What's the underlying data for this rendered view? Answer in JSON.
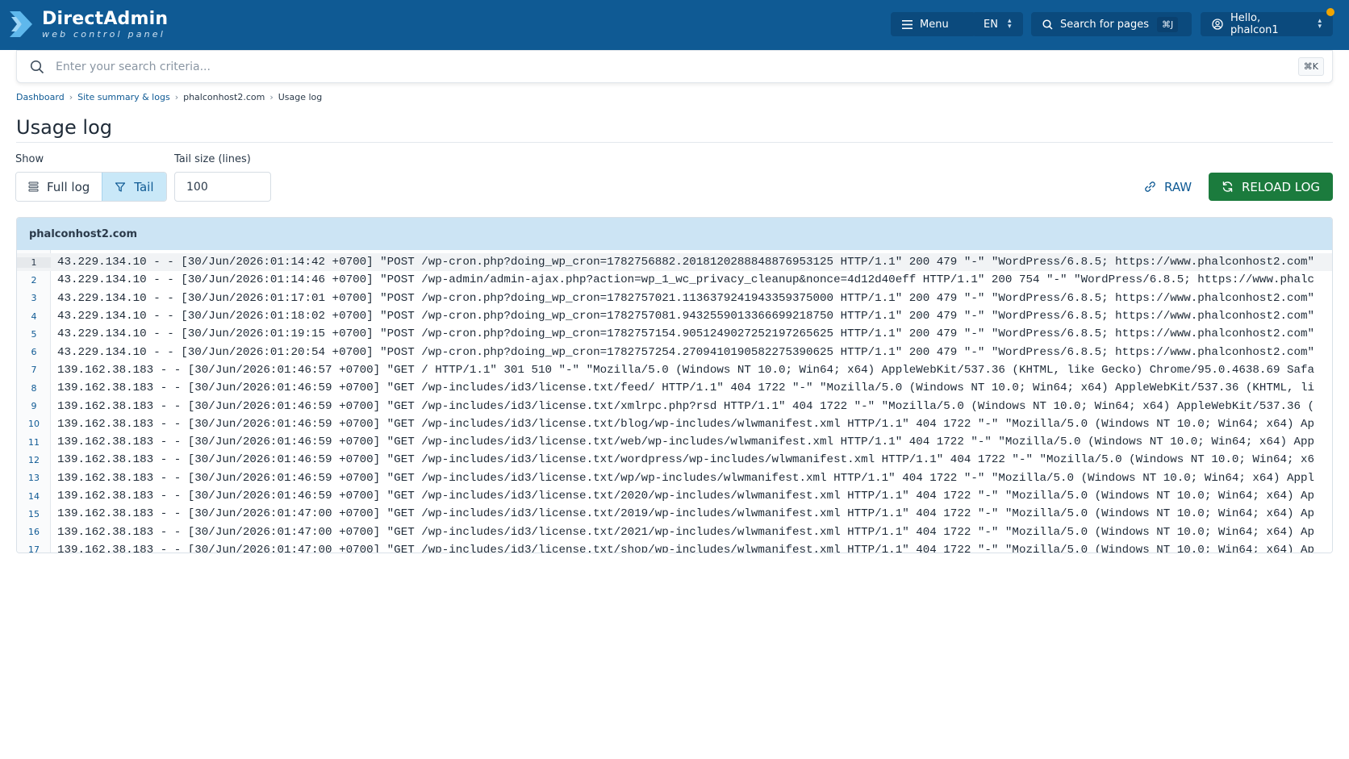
{
  "brand": {
    "title": "DirectAdmin",
    "subtitle": "web control panel"
  },
  "header": {
    "menu_label": "Menu",
    "language": "EN",
    "search_pages_label": "Search for pages",
    "search_pages_shortcut": "⌘J",
    "user_label": "Hello, phalcon1"
  },
  "search": {
    "placeholder": "Enter your search criteria...",
    "shortcut": "⌘K"
  },
  "breadcrumb": [
    "Dashboard",
    "Site summary & logs",
    "phalconhost2.com",
    "Usage log"
  ],
  "page": {
    "title": "Usage log"
  },
  "controls": {
    "show_label": "Show",
    "full_log_label": "Full log",
    "tail_label": "Tail",
    "tail_size_label": "Tail size (lines)",
    "tail_size_value": "100",
    "raw_label": "RAW",
    "reload_label": "RELOAD LOG"
  },
  "log": {
    "domain": "phalconhost2.com",
    "active_line": 1,
    "lines": [
      {
        "n": "1",
        "text": "43.229.134.10 - - [30/Jun/2026:01:14:42 +0700] \"POST /wp-cron.php?doing_wp_cron=1782756882.2018120288848876953125 HTTP/1.1\" 200 479 \"-\" \"WordPress/6.8.5; https://www.phalconhost2.com\""
      },
      {
        "n": "2",
        "text": "43.229.134.10 - - [30/Jun/2026:01:14:46 +0700] \"POST /wp-admin/admin-ajax.php?action=wp_1_wc_privacy_cleanup&nonce=4d12d40eff HTTP/1.1\" 200 754 \"-\" \"WordPress/6.8.5; https://www.phalc"
      },
      {
        "n": "3",
        "text": "43.229.134.10 - - [30/Jun/2026:01:17:01 +0700] \"POST /wp-cron.php?doing_wp_cron=1782757021.1136379241943359375000 HTTP/1.1\" 200 479 \"-\" \"WordPress/6.8.5; https://www.phalconhost2.com\""
      },
      {
        "n": "4",
        "text": "43.229.134.10 - - [30/Jun/2026:01:18:02 +0700] \"POST /wp-cron.php?doing_wp_cron=1782757081.9432559013366699218750 HTTP/1.1\" 200 479 \"-\" \"WordPress/6.8.5; https://www.phalconhost2.com\""
      },
      {
        "n": "5",
        "text": "43.229.134.10 - - [30/Jun/2026:01:19:15 +0700] \"POST /wp-cron.php?doing_wp_cron=1782757154.9051249027252197265625 HTTP/1.1\" 200 479 \"-\" \"WordPress/6.8.5; https://www.phalconhost2.com\""
      },
      {
        "n": "6",
        "text": "43.229.134.10 - - [30/Jun/2026:01:20:54 +0700] \"POST /wp-cron.php?doing_wp_cron=1782757254.2709410190582275390625 HTTP/1.1\" 200 479 \"-\" \"WordPress/6.8.5; https://www.phalconhost2.com\""
      },
      {
        "n": "7",
        "text": "139.162.38.183 - - [30/Jun/2026:01:46:57 +0700] \"GET / HTTP/1.1\" 301 510 \"-\" \"Mozilla/5.0 (Windows NT 10.0; Win64; x64) AppleWebKit/537.36 (KHTML, like Gecko) Chrome/95.0.4638.69 Safa"
      },
      {
        "n": "8",
        "text": "139.162.38.183 - - [30/Jun/2026:01:46:59 +0700] \"GET /wp-includes/id3/license.txt/feed/ HTTP/1.1\" 404 1722 \"-\" \"Mozilla/5.0 (Windows NT 10.0; Win64; x64) AppleWebKit/537.36 (KHTML, li"
      },
      {
        "n": "9",
        "text": "139.162.38.183 - - [30/Jun/2026:01:46:59 +0700] \"GET /wp-includes/id3/license.txt/xmlrpc.php?rsd HTTP/1.1\" 404 1722 \"-\" \"Mozilla/5.0 (Windows NT 10.0; Win64; x64) AppleWebKit/537.36 ("
      },
      {
        "n": "10",
        "text": "139.162.38.183 - - [30/Jun/2026:01:46:59 +0700] \"GET /wp-includes/id3/license.txt/blog/wp-includes/wlwmanifest.xml HTTP/1.1\" 404 1722 \"-\" \"Mozilla/5.0 (Windows NT 10.0; Win64; x64) Ap"
      },
      {
        "n": "11",
        "text": "139.162.38.183 - - [30/Jun/2026:01:46:59 +0700] \"GET /wp-includes/id3/license.txt/web/wp-includes/wlwmanifest.xml HTTP/1.1\" 404 1722 \"-\" \"Mozilla/5.0 (Windows NT 10.0; Win64; x64) App"
      },
      {
        "n": "12",
        "text": "139.162.38.183 - - [30/Jun/2026:01:46:59 +0700] \"GET /wp-includes/id3/license.txt/wordpress/wp-includes/wlwmanifest.xml HTTP/1.1\" 404 1722 \"-\" \"Mozilla/5.0 (Windows NT 10.0; Win64; x6"
      },
      {
        "n": "13",
        "text": "139.162.38.183 - - [30/Jun/2026:01:46:59 +0700] \"GET /wp-includes/id3/license.txt/wp/wp-includes/wlwmanifest.xml HTTP/1.1\" 404 1722 \"-\" \"Mozilla/5.0 (Windows NT 10.0; Win64; x64) Appl"
      },
      {
        "n": "14",
        "text": "139.162.38.183 - - [30/Jun/2026:01:46:59 +0700] \"GET /wp-includes/id3/license.txt/2020/wp-includes/wlwmanifest.xml HTTP/1.1\" 404 1722 \"-\" \"Mozilla/5.0 (Windows NT 10.0; Win64; x64) Ap"
      },
      {
        "n": "15",
        "text": "139.162.38.183 - - [30/Jun/2026:01:47:00 +0700] \"GET /wp-includes/id3/license.txt/2019/wp-includes/wlwmanifest.xml HTTP/1.1\" 404 1722 \"-\" \"Mozilla/5.0 (Windows NT 10.0; Win64; x64) Ap"
      },
      {
        "n": "16",
        "text": "139.162.38.183 - - [30/Jun/2026:01:47:00 +0700] \"GET /wp-includes/id3/license.txt/2021/wp-includes/wlwmanifest.xml HTTP/1.1\" 404 1722 \"-\" \"Mozilla/5.0 (Windows NT 10.0; Win64; x64) Ap"
      },
      {
        "n": "17",
        "text": "139.162.38.183 - - [30/Jun/2026:01:47:00 +0700] \"GET /wp-includes/id3/license.txt/shop/wp-includes/wlwmanifest.xml HTTP/1.1\" 404 1722 \"-\" \"Mozilla/5.0 (Windows NT 10.0; Win64; x64) Ap"
      }
    ]
  },
  "colors": {
    "header_bg": "#0f5a94",
    "accent": "#0f5a94",
    "reload_button": "#1b7b3d",
    "tail_active": "#c9e8f8",
    "notification_dot": "#f0a500"
  }
}
